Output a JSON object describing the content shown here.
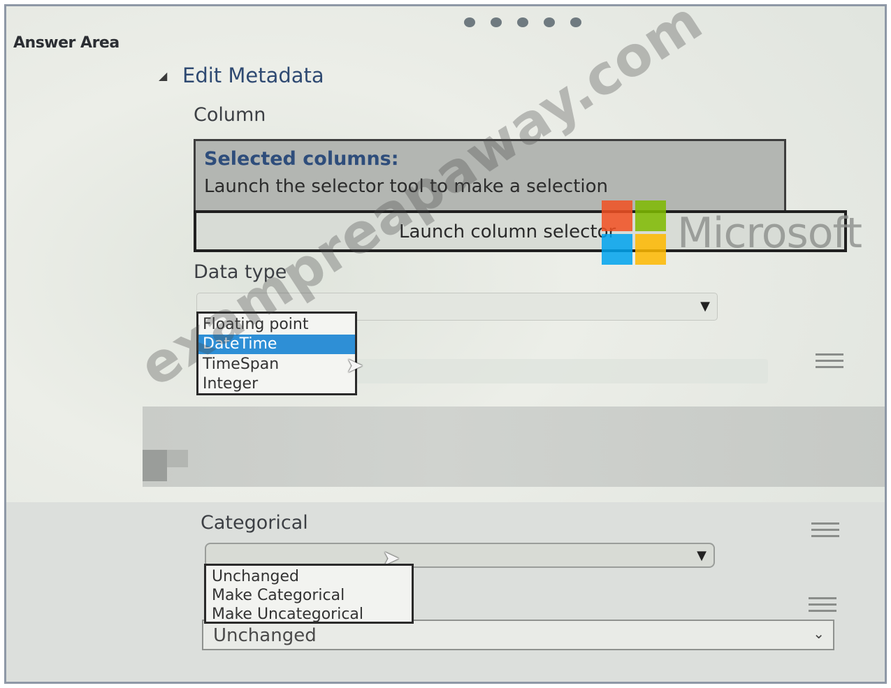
{
  "header": {
    "answer_area": "Answer Area",
    "section_title": "Edit Metadata",
    "page_dot_count": 5
  },
  "column": {
    "label": "Column",
    "selected_title": "Selected columns:",
    "selected_hint": "Launch the selector tool to make a selection",
    "launch_button": "Launch column selector"
  },
  "data_type": {
    "label": "Data type",
    "options": [
      "Floating point",
      "DateTime",
      "TimeSpan",
      "Integer"
    ],
    "highlighted": "DateTime"
  },
  "categorical": {
    "label": "Categorical",
    "options": [
      "Unchanged",
      "Make Categorical",
      "Make Uncategorical"
    ]
  },
  "bottom_field": {
    "value": "Unchanged"
  },
  "watermark": {
    "brand_word": "Microsoft",
    "site_text": "exampreapaway.com"
  },
  "colors": {
    "section_title": "#2f4a72",
    "highlight": "#2e8fd6",
    "ms_red": "#f25022",
    "ms_green": "#7fba00",
    "ms_blue": "#00a4ef",
    "ms_yellow": "#ffb900"
  },
  "icons": {
    "collapse": "collapse-triangle-icon",
    "dropdown": "chevron-down-icon",
    "drag_handle": "hamburger-grip-icon",
    "pointer": "mouse-cursor-icon"
  }
}
